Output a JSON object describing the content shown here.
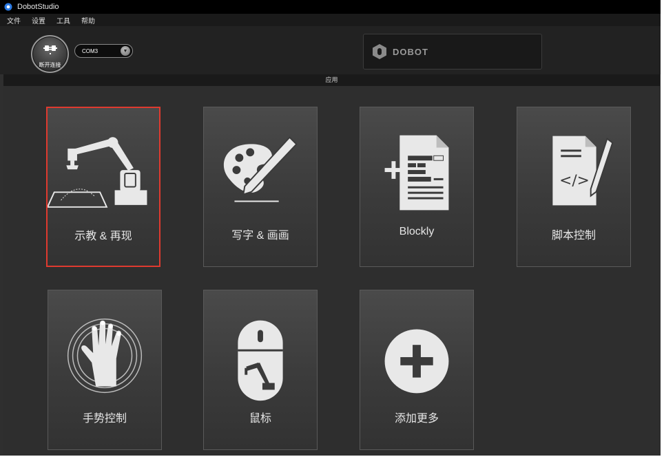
{
  "window": {
    "title": "DobotStudio"
  },
  "menu": {
    "items": [
      "文件",
      "设置",
      "工具",
      "帮助"
    ]
  },
  "toolbar": {
    "connect_label": "断开连接",
    "port_value": "COM3",
    "logo_text": "DOBOT"
  },
  "section": {
    "title": "应用"
  },
  "tiles": [
    {
      "label": "示教 & 再现",
      "icon": "robot-arm-icon",
      "selected": true
    },
    {
      "label": "写字 & 画画",
      "icon": "palette-pencil-icon",
      "selected": false
    },
    {
      "label": "Blockly",
      "icon": "blockly-document-icon",
      "selected": false
    },
    {
      "label": "脚本控制",
      "icon": "script-document-icon",
      "selected": false
    },
    {
      "label": "手势控制",
      "icon": "hand-gesture-icon",
      "selected": false
    },
    {
      "label": "鼠标",
      "icon": "mouse-icon",
      "selected": false
    },
    {
      "label": "添加更多",
      "icon": "plus-circle-icon",
      "selected": false
    }
  ],
  "colors": {
    "selection_border": "#e03a2f",
    "background": "#2f2f2f",
    "icon_color": "#e8e8e8"
  }
}
